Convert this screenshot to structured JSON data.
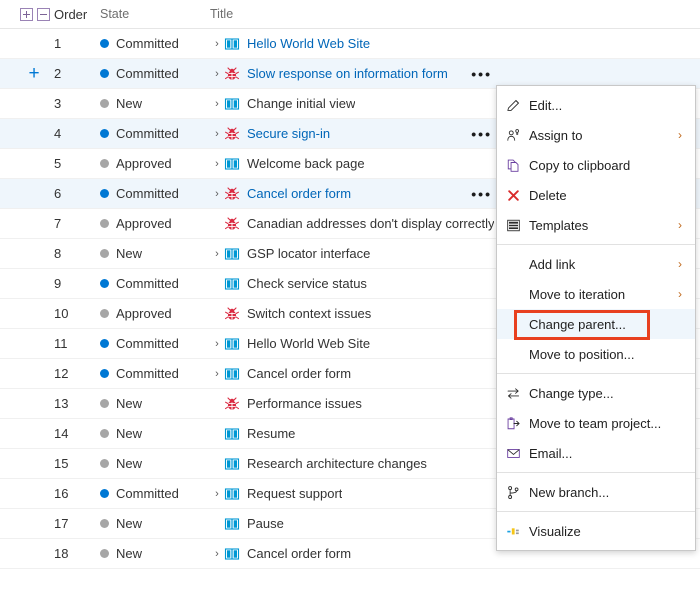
{
  "grid": {
    "header": {
      "expand_all_icon": "plus-box-icon",
      "collapse_all_icon": "minus-box-icon",
      "columns": [
        "Order",
        "State",
        "Title"
      ]
    },
    "state_colors": {
      "Committed": "#0078d4",
      "New": "#a6a6a6",
      "Approved": "#a6a6a6"
    },
    "icon_colors": {
      "user_story": "#0098d4",
      "bug": "#da2b42"
    },
    "rows": [
      {
        "order": "1",
        "state": "Committed",
        "title": "Hello World Web Site",
        "icon": "user-story-icon",
        "chevron": true,
        "link": true,
        "highlighted": false,
        "ellipsis": false,
        "plus": false
      },
      {
        "order": "2",
        "state": "Committed",
        "title": "Slow response on information form",
        "icon": "bug-icon",
        "chevron": true,
        "link": true,
        "highlighted": true,
        "ellipsis": true,
        "plus": true
      },
      {
        "order": "3",
        "state": "New",
        "title": "Change initial view",
        "icon": "user-story-icon",
        "chevron": true,
        "link": false,
        "highlighted": false,
        "ellipsis": false,
        "plus": false
      },
      {
        "order": "4",
        "state": "Committed",
        "title": "Secure sign-in",
        "icon": "bug-icon",
        "chevron": true,
        "link": true,
        "highlighted": true,
        "ellipsis": true,
        "plus": false
      },
      {
        "order": "5",
        "state": "Approved",
        "title": "Welcome back page",
        "icon": "user-story-icon",
        "chevron": true,
        "link": false,
        "highlighted": false,
        "ellipsis": false,
        "plus": false
      },
      {
        "order": "6",
        "state": "Committed",
        "title": "Cancel order form",
        "icon": "bug-icon",
        "chevron": true,
        "link": true,
        "highlighted": true,
        "ellipsis": true,
        "plus": false
      },
      {
        "order": "7",
        "state": "Approved",
        "title": "Canadian addresses don't display correctly",
        "icon": "bug-icon",
        "chevron": false,
        "link": false,
        "highlighted": false,
        "ellipsis": false,
        "plus": false
      },
      {
        "order": "8",
        "state": "New",
        "title": "GSP locator interface",
        "icon": "user-story-icon",
        "chevron": true,
        "link": false,
        "highlighted": false,
        "ellipsis": false,
        "plus": false
      },
      {
        "order": "9",
        "state": "Committed",
        "title": "Check service status",
        "icon": "user-story-icon",
        "chevron": false,
        "link": false,
        "highlighted": false,
        "ellipsis": false,
        "plus": false
      },
      {
        "order": "10",
        "state": "Approved",
        "title": "Switch context issues",
        "icon": "bug-icon",
        "chevron": false,
        "link": false,
        "highlighted": false,
        "ellipsis": false,
        "plus": false
      },
      {
        "order": "11",
        "state": "Committed",
        "title": "Hello World Web Site",
        "icon": "user-story-icon",
        "chevron": true,
        "link": false,
        "highlighted": false,
        "ellipsis": false,
        "plus": false
      },
      {
        "order": "12",
        "state": "Committed",
        "title": "Cancel order form",
        "icon": "user-story-icon",
        "chevron": true,
        "link": false,
        "highlighted": false,
        "ellipsis": false,
        "plus": false
      },
      {
        "order": "13",
        "state": "New",
        "title": "Performance issues",
        "icon": "bug-icon",
        "chevron": false,
        "link": false,
        "highlighted": false,
        "ellipsis": false,
        "plus": false
      },
      {
        "order": "14",
        "state": "New",
        "title": "Resume",
        "icon": "user-story-icon",
        "chevron": false,
        "link": false,
        "highlighted": false,
        "ellipsis": false,
        "plus": false
      },
      {
        "order": "15",
        "state": "New",
        "title": "Research architecture changes",
        "icon": "user-story-icon",
        "chevron": false,
        "link": false,
        "highlighted": false,
        "ellipsis": false,
        "plus": false
      },
      {
        "order": "16",
        "state": "Committed",
        "title": "Request support",
        "icon": "user-story-icon",
        "chevron": true,
        "link": false,
        "highlighted": false,
        "ellipsis": false,
        "plus": false
      },
      {
        "order": "17",
        "state": "New",
        "title": "Pause",
        "icon": "user-story-icon",
        "chevron": false,
        "link": false,
        "highlighted": false,
        "ellipsis": false,
        "plus": false
      },
      {
        "order": "18",
        "state": "New",
        "title": "Cancel order form",
        "icon": "user-story-icon",
        "chevron": true,
        "link": false,
        "highlighted": false,
        "ellipsis": false,
        "plus": false
      }
    ]
  },
  "context_menu": {
    "highlight_color": "#e8401f",
    "items": [
      {
        "label": "Edit...",
        "icon": "pencil-icon",
        "submenu": false,
        "sep_after": false,
        "highlighted": false
      },
      {
        "label": "Assign to",
        "icon": "assign-person-icon",
        "submenu": true,
        "sep_after": false,
        "highlighted": false
      },
      {
        "label": "Copy to clipboard",
        "icon": "copy-icon",
        "submenu": false,
        "sep_after": false,
        "highlighted": false
      },
      {
        "label": "Delete",
        "icon": "delete-x-icon",
        "submenu": false,
        "sep_after": false,
        "highlighted": false
      },
      {
        "label": "Templates",
        "icon": "templates-icon",
        "submenu": true,
        "sep_after": true,
        "highlighted": false
      },
      {
        "label": "Add link",
        "icon": "none",
        "submenu": true,
        "sep_after": false,
        "highlighted": false
      },
      {
        "label": "Move to iteration",
        "icon": "none",
        "submenu": true,
        "sep_after": false,
        "highlighted": false
      },
      {
        "label": "Change parent...",
        "icon": "none",
        "submenu": false,
        "sep_after": false,
        "highlighted": true
      },
      {
        "label": "Move to position...",
        "icon": "none",
        "submenu": false,
        "sep_after": true,
        "highlighted": false
      },
      {
        "label": "Change type...",
        "icon": "change-type-icon",
        "submenu": false,
        "sep_after": false,
        "highlighted": false
      },
      {
        "label": "Move to team project...",
        "icon": "move-project-icon",
        "submenu": false,
        "sep_after": false,
        "highlighted": false
      },
      {
        "label": "Email...",
        "icon": "email-icon",
        "submenu": false,
        "sep_after": true,
        "highlighted": false
      },
      {
        "label": "New branch...",
        "icon": "branch-icon",
        "submenu": false,
        "sep_after": true,
        "highlighted": false
      },
      {
        "label": "Visualize",
        "icon": "visualize-icon",
        "submenu": false,
        "sep_after": false,
        "highlighted": false
      }
    ]
  }
}
